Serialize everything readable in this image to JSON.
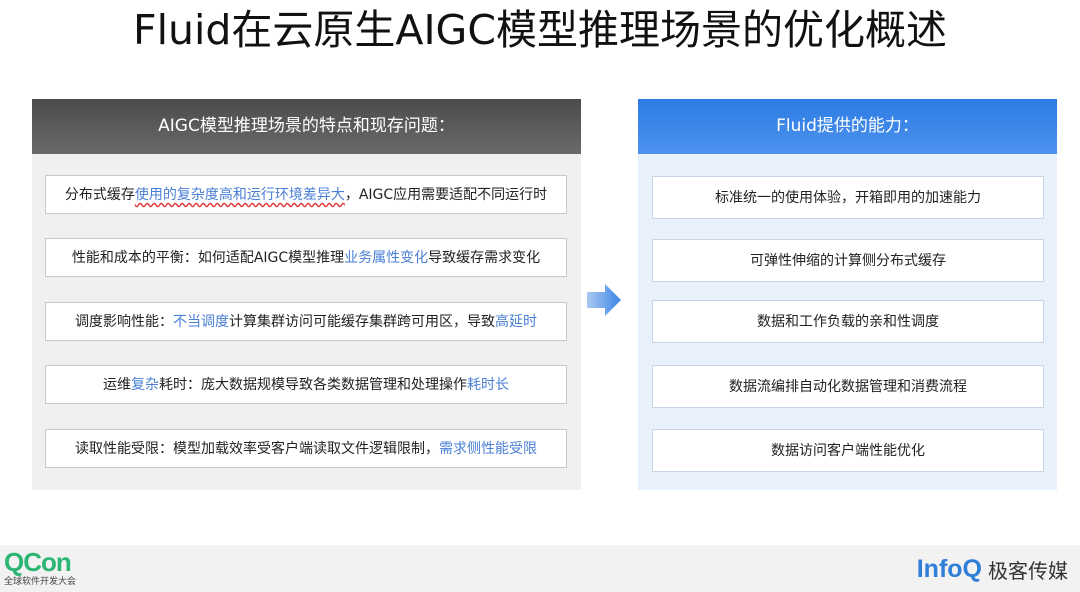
{
  "title": "Fluid在云原生AIGC模型推理场景的优化概述",
  "left": {
    "header": "AIGC模型推理场景的特点和现存问题：",
    "rows": [
      [
        {
          "text": "分布式缓存",
          "style": "plain"
        },
        {
          "text": "使用的复杂度高和运行环境差异大",
          "style": "hl-wavy"
        },
        {
          "text": "，AIGC应用需要适配不同运行时",
          "style": "plain"
        }
      ],
      [
        {
          "text": "性能和成本的平衡：如何适配AIGC模型推理",
          "style": "plain"
        },
        {
          "text": "业务属性变化",
          "style": "hl"
        },
        {
          "text": "导致缓存需求变化",
          "style": "plain"
        }
      ],
      [
        {
          "text": "调度影响性能：",
          "style": "plain"
        },
        {
          "text": "不当调度",
          "style": "hl"
        },
        {
          "text": "计算集群访问可能缓存集群跨可用区，导致",
          "style": "plain"
        },
        {
          "text": "高延时",
          "style": "hl"
        }
      ],
      [
        {
          "text": "运维",
          "style": "plain"
        },
        {
          "text": "复杂",
          "style": "hl"
        },
        {
          "text": "耗时：庞大数据规模导致各类数据管理和处理操作",
          "style": "plain"
        },
        {
          "text": "耗时长",
          "style": "hl"
        }
      ],
      [
        {
          "text": "读取性能受限：模型加载效率受客户端读取文件逻辑限制，",
          "style": "plain"
        },
        {
          "text": "需求侧性能受限",
          "style": "hl"
        }
      ]
    ]
  },
  "right": {
    "header": "Fluid提供的能力：",
    "rows": [
      "标准统一的使用体验，开箱即用的加速能力",
      "可弹性伸缩的计算侧分布式缓存",
      "数据和工作负载的亲和性调度",
      "数据流编排自动化数据管理和消费流程",
      "数据访问客户端性能优化"
    ]
  },
  "footer": {
    "qcon_logo": "QCon",
    "qcon_subtitle": "全球软件开发大会",
    "infoq_logo": "InfoQ",
    "infoq_cn": "极客传媒"
  },
  "colors": {
    "highlight": "#4a7fd6",
    "left_header": "#555555",
    "right_header": "#2d7be4",
    "arrow": "#3d86e6",
    "qcon": "#2bb673",
    "infoq": "#2f7fd8"
  },
  "icons": {
    "arrow": "right-arrow-icon"
  }
}
